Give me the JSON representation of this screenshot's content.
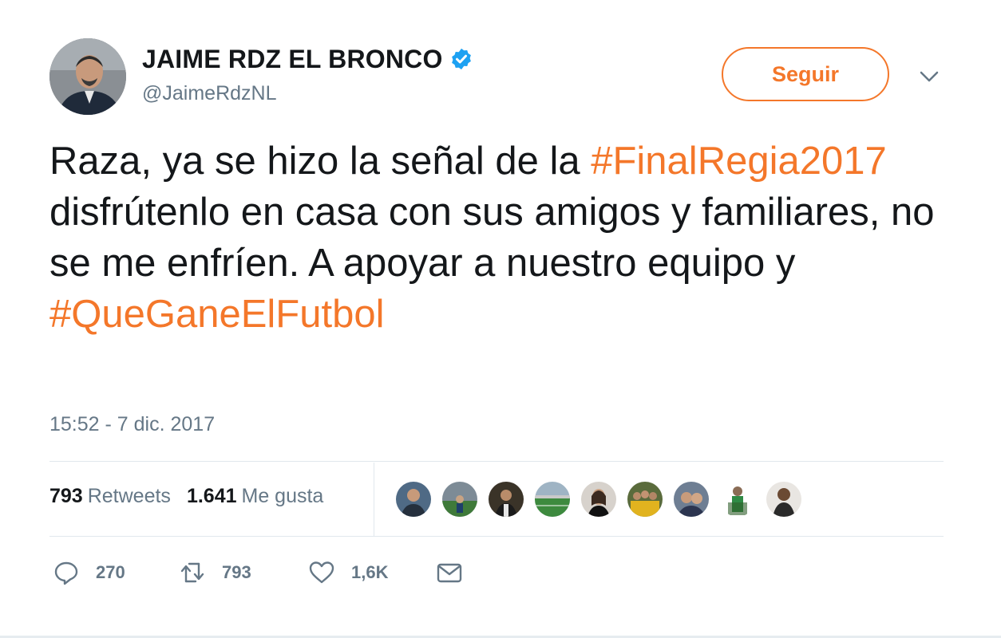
{
  "author": {
    "name": "JAIME RDZ EL BRONCO",
    "handle": "@JaimeRdzNL",
    "verified": true
  },
  "follow_button": {
    "label": "Seguir"
  },
  "tweet": {
    "text_segments": [
      {
        "text": "Raza, ya se hizo la señal de la ",
        "type": "text"
      },
      {
        "text": "#FinalRegia2017",
        "type": "hashtag"
      },
      {
        "text": " disfrútenlo en casa con sus amigos y familiares, no se me enfríen. A apoyar a nuestro equipo y ",
        "type": "text"
      },
      {
        "text": "#QueGaneElFutbol",
        "type": "hashtag"
      }
    ],
    "timestamp": "15:52 - 7 dic. 2017"
  },
  "stats": {
    "retweets_count": "793",
    "retweets_label": "Retweets",
    "likes_count": "1.641",
    "likes_label": "Me gusta"
  },
  "actions": {
    "reply_count": "270",
    "retweet_count": "793",
    "like_count": "1,6K"
  },
  "colors": {
    "accent": "#f4772a",
    "text": "#14171a",
    "secondary": "#657786",
    "verified": "#1da1f2",
    "divider": "#e1e8ed"
  },
  "icons": {
    "verified": "verified-badge-icon",
    "menu": "chevron-down-icon",
    "reply": "reply-icon",
    "retweet": "retweet-icon",
    "like": "heart-icon",
    "dm": "envelope-icon"
  },
  "liker_avatars": [
    {
      "name": "liker-avatar-1"
    },
    {
      "name": "liker-avatar-2"
    },
    {
      "name": "liker-avatar-3"
    },
    {
      "name": "liker-avatar-4"
    },
    {
      "name": "liker-avatar-5"
    },
    {
      "name": "liker-avatar-6"
    },
    {
      "name": "liker-avatar-7"
    },
    {
      "name": "liker-avatar-8"
    },
    {
      "name": "liker-avatar-9"
    }
  ]
}
